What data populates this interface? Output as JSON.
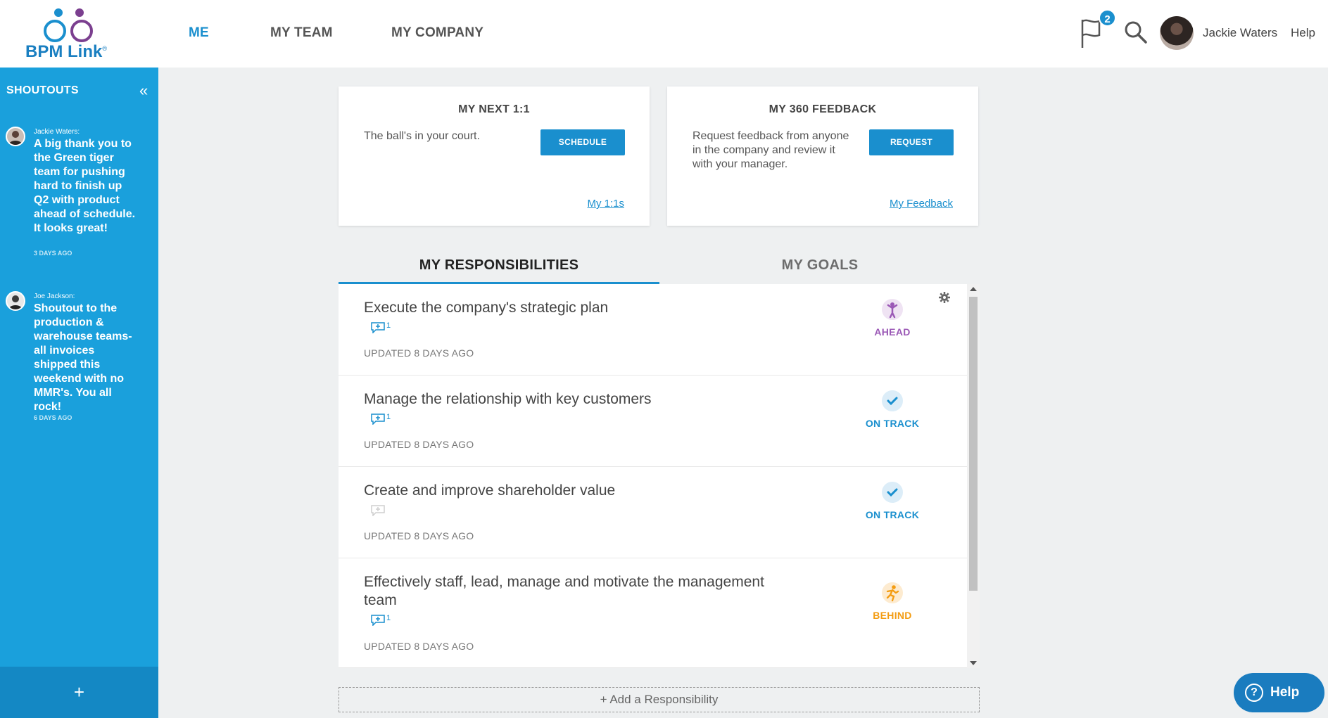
{
  "app": {
    "logo_text": "BPM Link",
    "logo_mark": "®"
  },
  "nav": {
    "items": [
      {
        "label": "ME",
        "active": true
      },
      {
        "label": "MY TEAM",
        "active": false
      },
      {
        "label": "MY COMPANY",
        "active": false
      }
    ]
  },
  "header": {
    "notifications_count": "2",
    "user_name": "Jackie Waters",
    "help_label": "Help"
  },
  "sidebar": {
    "title": "SHOUTOUTS",
    "shoutouts": [
      {
        "author": "Jackie Waters:",
        "message": "A big thank you to the Green tiger team for pushing hard to finish up Q2 with product ahead of schedule. It looks great!",
        "time": "3 DAYS AGO"
      },
      {
        "author": "Joe Jackson:",
        "message": "Shoutout to the production & warehouse teams-all invoices shipped this weekend with no MMR's. You all rock!",
        "time": "6 DAYS AGO"
      }
    ],
    "add_label": "+"
  },
  "cards": {
    "next_one_on_one": {
      "title": "MY NEXT 1:1",
      "description": "The ball's in your court.",
      "button": "SCHEDULE",
      "link": "My 1:1s"
    },
    "feedback": {
      "title": "MY 360 FEEDBACK",
      "description": "Request feedback from anyone in the company and review it with your manager.",
      "button": "REQUEST",
      "link": "My Feedback"
    }
  },
  "tabs": [
    {
      "label": "MY RESPONSIBILITIES",
      "active": true
    },
    {
      "label": "MY GOALS",
      "active": false
    }
  ],
  "responsibilities": [
    {
      "title": "Execute the company's strategic plan",
      "comments": "1",
      "updated": "UPDATED 8 DAYS AGO",
      "status": "AHEAD"
    },
    {
      "title": "Manage the relationship with key customers",
      "comments": "1",
      "updated": "UPDATED 8 DAYS AGO",
      "status": "ON TRACK"
    },
    {
      "title": "Create and improve shareholder value",
      "comments": "",
      "updated": "UPDATED 8 DAYS AGO",
      "status": "ON TRACK"
    },
    {
      "title": "Effectively staff, lead, manage and motivate the management team",
      "comments": "1",
      "updated": "UPDATED 8 DAYS AGO",
      "status": "BEHIND"
    }
  ],
  "status_colors": {
    "AHEAD": "#9b59b6",
    "ON TRACK": "#1a8fce",
    "BEHIND": "#f39c12"
  },
  "add_responsibility": "+ Add a Responsibility",
  "help_button": "Help"
}
